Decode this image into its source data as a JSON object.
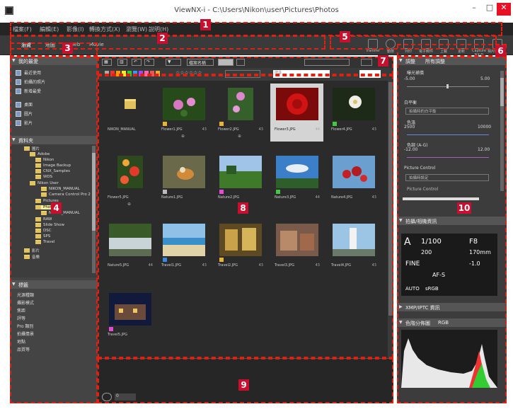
{
  "window": {
    "title": "ViewNX-i - C:\\Users\\Nikon\\user\\Pictures\\Photos"
  },
  "colors": {
    "callout": "#c8102e",
    "selection": "#d4d4d4",
    "tree_selection": "#f6f3a0"
  },
  "callouts": [
    "1",
    "2",
    "3",
    "4",
    "5",
    "6",
    "7",
    "8",
    "9",
    "10"
  ],
  "menu": [
    "檔案(F)",
    "編輯(E)",
    "影像(I)",
    "轉換方式(X)",
    "瀏覽(W)",
    "說明(H)"
  ],
  "workspace_tabs": [
    "瀏覽",
    "地圖",
    "Web",
    "Movie"
  ],
  "tools": [
    "Transfer",
    "動態",
    "列印",
    "電子郵件",
    "上載",
    "更新",
    "Capture NX-D",
    "相片編輯"
  ],
  "sidebar": {
    "quick_access_title": "我的最愛",
    "quick_links": [
      "最近使用",
      "拍攝的照片",
      "新增最愛"
    ],
    "quick_items": [
      "桌面",
      "圖片",
      "影片"
    ],
    "folders_title": "資料夾",
    "tree": [
      "圖片",
      "Adobe",
      "Nikon",
      "Image Backup",
      "CNX_Samples",
      "WDS",
      "Nikon User",
      "NIKON_MANUAL",
      "Camera Control Pro 2",
      "Pictures",
      "Photos",
      "NIKON_MANUAL",
      "RAW",
      "Slide Show",
      "DSC",
      "SPS",
      "Travel",
      "影片",
      "音樂"
    ],
    "keywords_title": "標籤",
    "keywords": [
      "光源種類",
      "攝影模式",
      "焦距",
      "評等",
      "Pro 類別",
      "拍攝情景",
      "地點",
      "品質等"
    ]
  },
  "toolbar": {
    "sort": "檔案名稱",
    "search_placeholder": "搜尋"
  },
  "photos": [
    {
      "name": "NIKON_MANUAL",
      "type": "folder"
    },
    {
      "name": "Flower1.JPG",
      "ext": "43",
      "type": "photo"
    },
    {
      "name": "Flower2.JPG",
      "ext": "43",
      "type": "photo"
    },
    {
      "name": "Flower3.JPG",
      "ext": "44",
      "type": "photo",
      "selected": true
    },
    {
      "name": "Flower4.JPG",
      "ext": "43",
      "type": "photo"
    },
    {
      "name": "Flower5.JPG",
      "ext": "",
      "type": "photo"
    },
    {
      "name": "Nature1.JPG",
      "ext": "",
      "type": "photo"
    },
    {
      "name": "Nature2.JPG",
      "ext": "",
      "type": "photo"
    },
    {
      "name": "Nature3.JPG",
      "ext": "44",
      "type": "photo"
    },
    {
      "name": "Nature4.JPG",
      "ext": "43",
      "type": "photo"
    },
    {
      "name": "Nature5.JPG",
      "ext": "44",
      "type": "photo"
    },
    {
      "name": "Travel1.JPG",
      "ext": "43",
      "type": "photo"
    },
    {
      "name": "Travel2.JPG",
      "ext": "43",
      "type": "photo"
    },
    {
      "name": "Travel3.JPG",
      "ext": "43",
      "type": "photo"
    },
    {
      "name": "Travel4.JPG",
      "ext": "43",
      "type": "photo"
    },
    {
      "name": "Travel5.JPG",
      "ext": "",
      "type": "photo"
    }
  ],
  "right": {
    "adjust_title": "調整",
    "adjust_preset": "所有調整",
    "exposure": "曝光補償",
    "exp_min": "-5.00",
    "exp_max": "5.00",
    "wb": "白平衡",
    "wb_select": "拍攝時的白平衡",
    "temp": "色溫",
    "temp_min": "2500",
    "temp_max": "10000",
    "tint": "色調 (A-G)",
    "tint_min": "-12.00",
    "tint_max": "12.00",
    "pc": "Picture Control",
    "pc_select": "拍攝時設定",
    "pc_label": "Picture Control",
    "info_title": "拍攝/相機資訊",
    "camera": {
      "mode": "A",
      "shutter": "1/100",
      "aperture": "F8",
      "iso": "200",
      "focal": "170mm",
      "quality": "FINE",
      "ev": "-1.0",
      "af": "AF-S",
      "cs": "sRGB",
      "auto": "AUTO"
    },
    "xmp_title": "XMP/IPTC 資訊",
    "histo_title": "色階分佈圖",
    "histo_mode": "RGB"
  },
  "status": {
    "count": "0"
  }
}
